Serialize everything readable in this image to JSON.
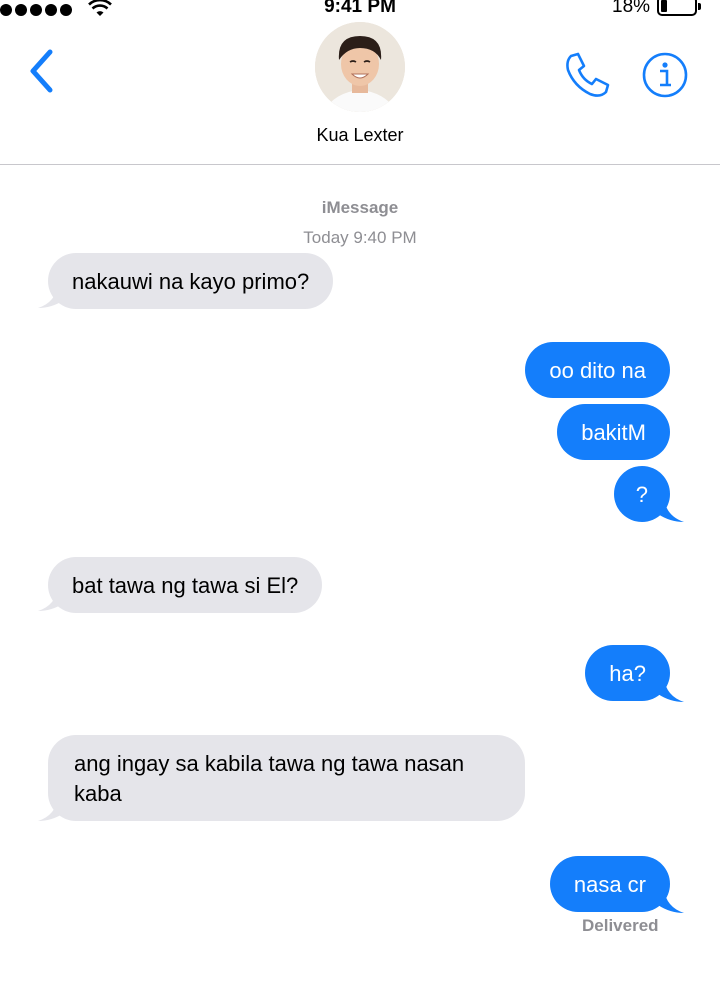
{
  "status_bar": {
    "time": "9:41 PM",
    "battery_percent": "18%",
    "battery_level": 0.18
  },
  "header": {
    "contact_name": "Kua Lexter"
  },
  "thread": {
    "service": "iMessage",
    "timestamp": "Today 9:40 PM",
    "messages": [
      {
        "direction": "incoming",
        "text": "nakauwi na kayo primo?"
      },
      {
        "direction": "outgoing",
        "text": "oo dito na"
      },
      {
        "direction": "outgoing",
        "text": "bakitM"
      },
      {
        "direction": "outgoing",
        "text": "?"
      },
      {
        "direction": "incoming",
        "text": "bat tawa ng tawa si El?"
      },
      {
        "direction": "outgoing",
        "text": "ha?"
      },
      {
        "direction": "incoming",
        "text": "ang ingay sa kabila tawa ng tawa nasan kaba"
      },
      {
        "direction": "outgoing",
        "text": "nasa cr"
      }
    ],
    "delivery_status": "Delivered"
  },
  "colors": {
    "accent": "#147efb",
    "incoming_bubble": "#e5e5ea",
    "secondary_text": "#8e8e93"
  },
  "icons": {
    "back": "chevron-left-icon",
    "call": "phone-icon",
    "info": "info-icon",
    "wifi": "wifi-icon",
    "signal": "signal-icon",
    "battery": "battery-icon"
  }
}
